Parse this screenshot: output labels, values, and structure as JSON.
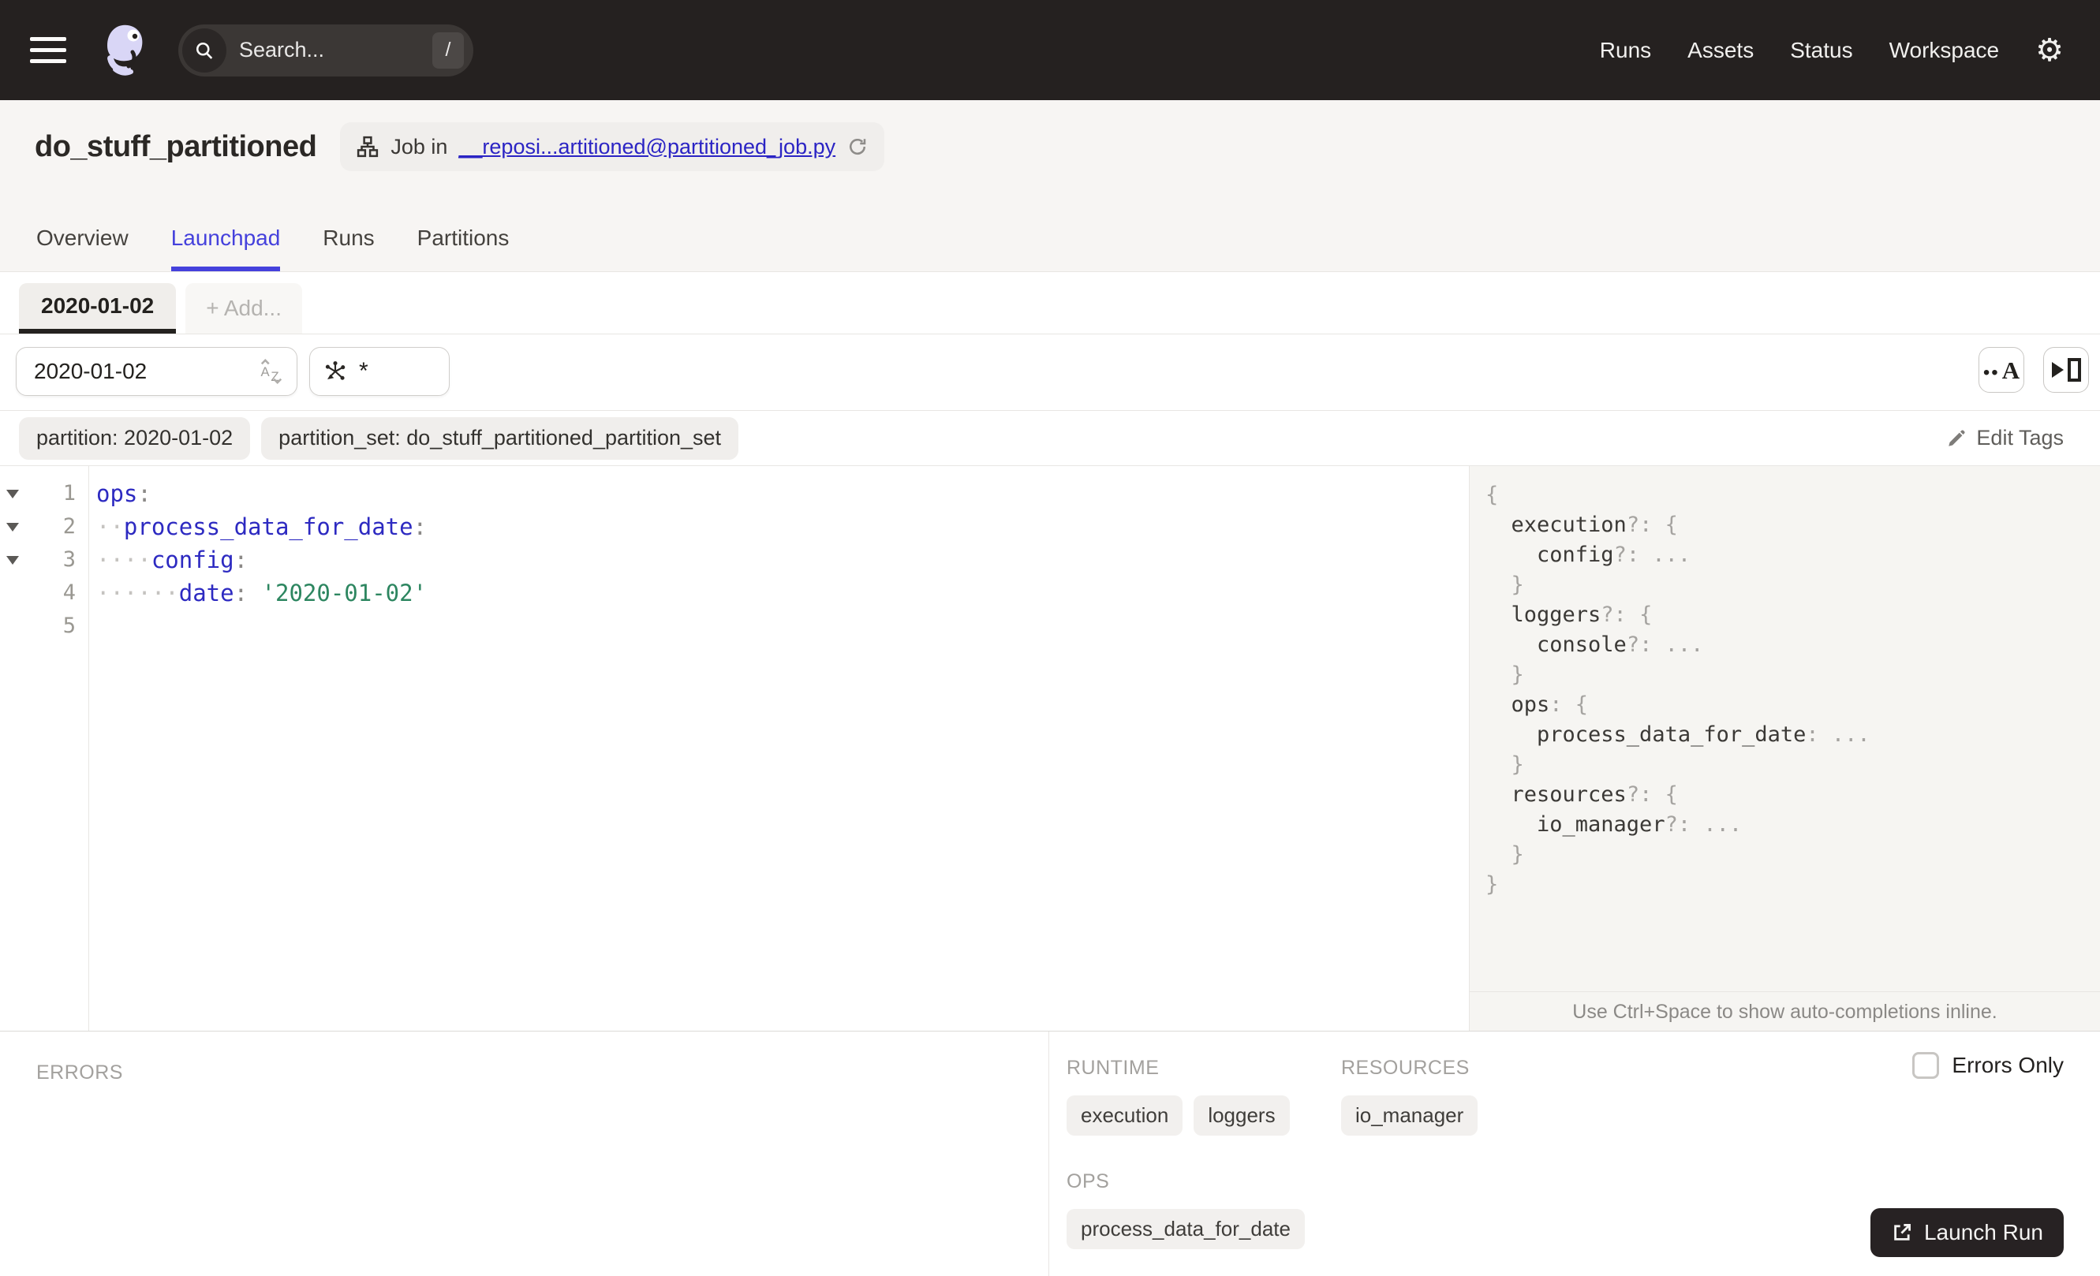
{
  "navbar": {
    "search": {
      "placeholder": "Search...",
      "shortcut": "/"
    },
    "links": [
      {
        "label": "Runs"
      },
      {
        "label": "Assets"
      },
      {
        "label": "Status"
      },
      {
        "label": "Workspace"
      }
    ],
    "gear_glyph": "⚙"
  },
  "header": {
    "title": "do_stuff_partitioned",
    "job_badge": {
      "prefix": "Job in",
      "link_text": "__reposi...artitioned@partitioned_job.py"
    },
    "tabs": [
      {
        "label": "Overview",
        "active": false
      },
      {
        "label": "Launchpad",
        "active": true
      },
      {
        "label": "Runs",
        "active": false
      },
      {
        "label": "Partitions",
        "active": false
      }
    ]
  },
  "launchpad": {
    "config_tab": "2020-01-02",
    "add_tab": "+ Add...",
    "partition_selector": {
      "value": "2020-01-02"
    },
    "op_selector": {
      "value": "*"
    },
    "tags": [
      {
        "label": "partition: 2020-01-02"
      },
      {
        "label": "partition_set: do_stuff_partitioned_partition_set"
      }
    ],
    "edit_tags": "Edit Tags"
  },
  "editor": {
    "lines": [
      {
        "number": "1",
        "fold": true,
        "segments": [
          {
            "cls": "key",
            "text": "ops"
          },
          {
            "cls": "punc",
            "text": ":"
          }
        ]
      },
      {
        "number": "2",
        "fold": true,
        "segments": [
          {
            "cls": "dots",
            "text": "··"
          },
          {
            "cls": "key",
            "text": "process_data_for_date"
          },
          {
            "cls": "punc",
            "text": ":"
          }
        ]
      },
      {
        "number": "3",
        "fold": true,
        "segments": [
          {
            "cls": "dots",
            "text": "····"
          },
          {
            "cls": "key",
            "text": "config"
          },
          {
            "cls": "punc",
            "text": ":"
          }
        ]
      },
      {
        "number": "4",
        "fold": false,
        "segments": [
          {
            "cls": "dots",
            "text": "······"
          },
          {
            "cls": "key",
            "text": "date"
          },
          {
            "cls": "punc",
            "text": ": "
          },
          {
            "cls": "str",
            "text": "'2020-01-02'"
          }
        ]
      },
      {
        "number": "5",
        "fold": false,
        "segments": []
      }
    ]
  },
  "schema": {
    "lines": [
      {
        "indent": 0,
        "segments": [
          {
            "cls": "dim",
            "text": "{"
          }
        ]
      },
      {
        "indent": 1,
        "segments": [
          {
            "cls": "prop",
            "text": "execution"
          },
          {
            "cls": "dim",
            "text": "?: {"
          }
        ]
      },
      {
        "indent": 2,
        "segments": [
          {
            "cls": "prop",
            "text": "config"
          },
          {
            "cls": "dim",
            "text": "?: ..."
          }
        ]
      },
      {
        "indent": 1,
        "segments": [
          {
            "cls": "dim",
            "text": "}"
          }
        ]
      },
      {
        "indent": 1,
        "segments": [
          {
            "cls": "prop",
            "text": "loggers"
          },
          {
            "cls": "dim",
            "text": "?: {"
          }
        ]
      },
      {
        "indent": 2,
        "segments": [
          {
            "cls": "prop",
            "text": "console"
          },
          {
            "cls": "dim",
            "text": "?: ..."
          }
        ]
      },
      {
        "indent": 1,
        "segments": [
          {
            "cls": "dim",
            "text": "}"
          }
        ]
      },
      {
        "indent": 1,
        "segments": [
          {
            "cls": "prop",
            "text": "ops"
          },
          {
            "cls": "dim",
            "text": ": {"
          }
        ]
      },
      {
        "indent": 2,
        "segments": [
          {
            "cls": "prop",
            "text": "process_data_for_date"
          },
          {
            "cls": "dim",
            "text": ": ..."
          }
        ]
      },
      {
        "indent": 1,
        "segments": [
          {
            "cls": "dim",
            "text": "}"
          }
        ]
      },
      {
        "indent": 1,
        "segments": [
          {
            "cls": "prop",
            "text": "resources"
          },
          {
            "cls": "dim",
            "text": "?: {"
          }
        ]
      },
      {
        "indent": 2,
        "segments": [
          {
            "cls": "prop",
            "text": "io_manager"
          },
          {
            "cls": "dim",
            "text": "?: ..."
          }
        ]
      },
      {
        "indent": 1,
        "segments": [
          {
            "cls": "dim",
            "text": "}"
          }
        ]
      },
      {
        "indent": 0,
        "segments": [
          {
            "cls": "dim",
            "text": "}"
          }
        ]
      }
    ],
    "hint": "Use Ctrl+Space to show auto-completions inline."
  },
  "bottom_panel": {
    "errors_label": "ERRORS",
    "errors_only_label": "Errors Only",
    "runtime": {
      "label": "RUNTIME",
      "chips": [
        {
          "label": "execution"
        },
        {
          "label": "loggers"
        }
      ]
    },
    "resources": {
      "label": "RESOURCES",
      "chips": [
        {
          "label": "io_manager"
        }
      ]
    },
    "ops": {
      "label": "OPS",
      "chips": [
        {
          "label": "process_data_for_date"
        }
      ]
    },
    "launch_button": "Launch Run"
  },
  "colors": {
    "navbar_bg": "#252120",
    "accent_tab_blue": "#4541dc",
    "link_blue": "#2b24c4",
    "yaml_key_blue": "#2d2ac1",
    "yaml_string_green": "#2d8660",
    "panel_bg": "#f6f5f2",
    "launch_button_bg": "#272223"
  }
}
